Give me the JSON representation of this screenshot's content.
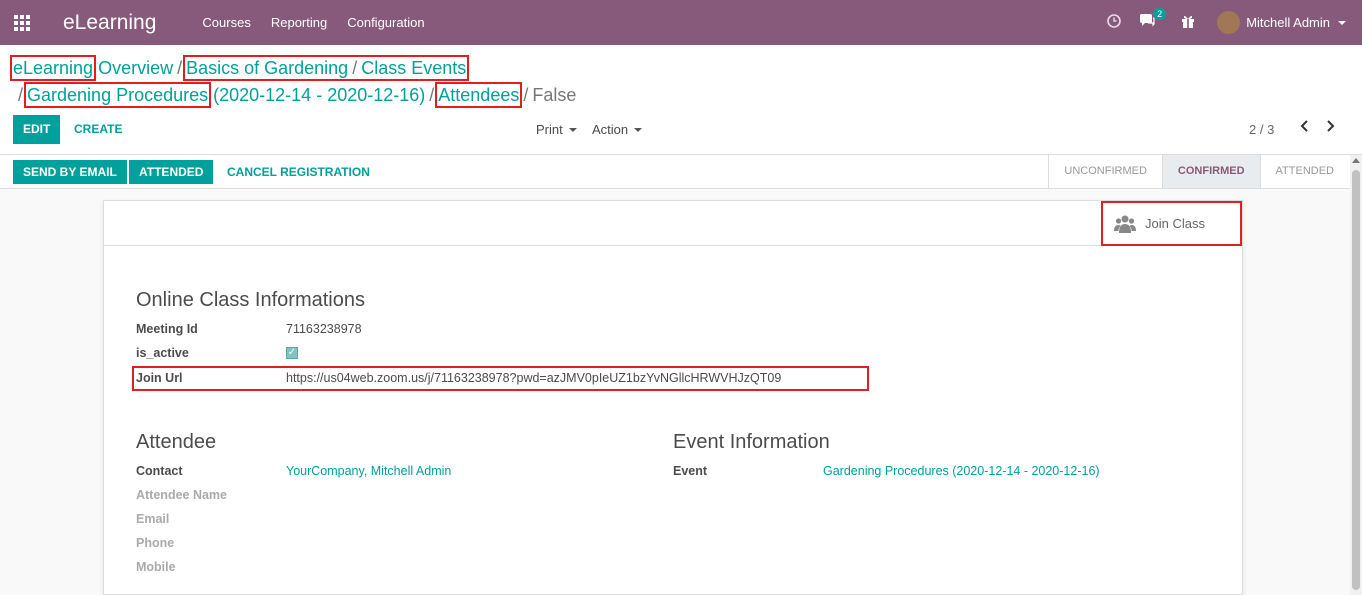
{
  "navbar": {
    "brand": "eLearning",
    "menu": [
      "Courses",
      "Reporting",
      "Configuration"
    ],
    "message_count": "2",
    "user_name": "Mitchell Admin"
  },
  "breadcrumb": {
    "items": [
      "eLearning Overview",
      "Basics of Gardening",
      "Class Events",
      "Gardening Procedures (2020-12-14 - 2020-12-16)",
      "Attendees"
    ],
    "current": "False"
  },
  "control": {
    "edit_label": "EDIT",
    "create_label": "CREATE",
    "print_label": "Print",
    "action_label": "Action",
    "pager": "2 / 3"
  },
  "statusbar": {
    "buttons": [
      "SEND BY EMAIL",
      "ATTENDED",
      "CANCEL REGISTRATION"
    ],
    "stages": [
      "UNCONFIRMED",
      "CONFIRMED",
      "ATTENDED"
    ],
    "active_stage": "CONFIRMED"
  },
  "sheet": {
    "join_label": "Join Class",
    "online_title": "Online Class Informations",
    "meeting_id_label": "Meeting Id",
    "meeting_id": "71163238978",
    "is_active_label": "is_active",
    "is_active": true,
    "join_url_label": "Join Url",
    "join_url": "https://us04web.zoom.us/j/71163238978?pwd=azJMV0pIeUZ1bzYvNGllcHRWVHJzQT09",
    "attendee_title": "Attendee",
    "contact_label": "Contact",
    "contact": "YourCompany, Mitchell Admin",
    "attendee_name_label": "Attendee Name",
    "email_label": "Email",
    "phone_label": "Phone",
    "mobile_label": "Mobile",
    "event_title": "Event Information",
    "event_label": "Event",
    "event": "Gardening Procedures (2020-12-14 - 2020-12-16)"
  },
  "colors": {
    "primary": "#875a7b",
    "accent": "#00a09d",
    "highlight": "#e02020"
  }
}
